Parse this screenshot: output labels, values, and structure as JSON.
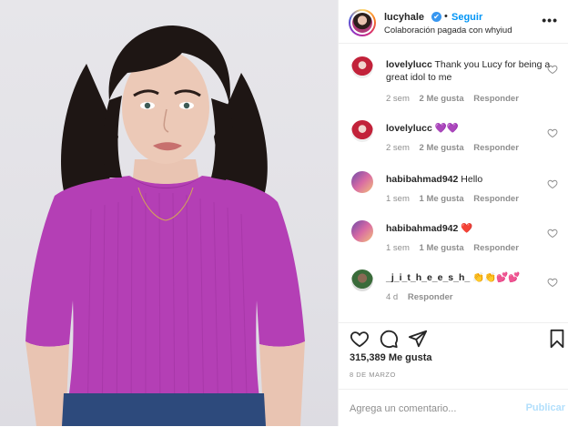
{
  "post": {
    "image_alt_subject": "",
    "author": {
      "username": "lucyhale",
      "verified_icon": "✔",
      "separator": "•",
      "follow_label": "Seguir",
      "subtitle": "Colaboración pagada con whyiud",
      "more_icon": "•••"
    },
    "comments": [
      {
        "username": "lovelylucc",
        "text": "Thank you Lucy for being a great idol to me",
        "age": "2 sem",
        "likes": "2 Me gusta",
        "reply": "Responder"
      },
      {
        "username": "lovelylucc",
        "text": "💜💜",
        "age": "2 sem",
        "likes": "2 Me gusta",
        "reply": "Responder"
      },
      {
        "username": "habibahmad942",
        "text": "Hello",
        "age": "1 sem",
        "likes": "1 Me gusta",
        "reply": "Responder"
      },
      {
        "username": "habibahmad942",
        "text": "❤️",
        "age": "1 sem",
        "likes": "1 Me gusta",
        "reply": "Responder"
      },
      {
        "username": "_j_i_t_h_e_e_s_h_",
        "text": "👏👏💕💕",
        "age": "4 d",
        "likes": "",
        "reply": "Responder"
      }
    ],
    "likes_count": "315,389 Me gusta",
    "date": "8 DE MARZO",
    "comment_input": {
      "placeholder": "Agrega un comentario...",
      "value": ""
    },
    "publish_label": "Publicar",
    "colors": {
      "accent": "#0095f6",
      "publish_disabled": "#b2dffc",
      "shirt": "#b43fb5",
      "muted": "#8e8e8e"
    }
  }
}
